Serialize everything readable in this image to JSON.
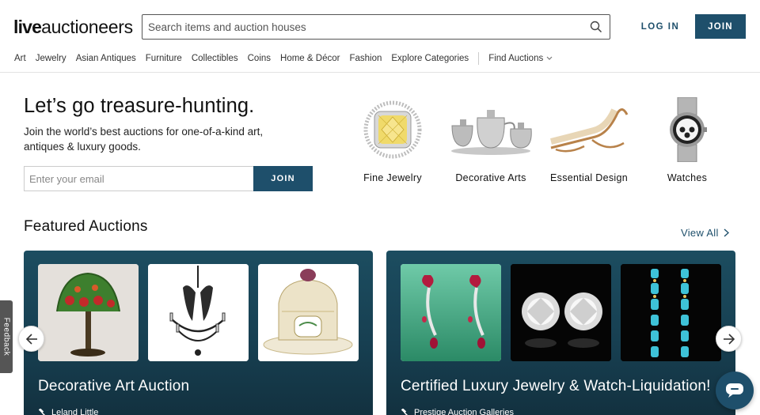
{
  "header": {
    "logo_live": "live",
    "logo_rest": "auctioneers",
    "search_placeholder": "Search items and auction houses",
    "login_label": "LOG IN",
    "join_label": "JOIN"
  },
  "nav": {
    "items": [
      "Art",
      "Jewelry",
      "Asian Antiques",
      "Furniture",
      "Collectibles",
      "Coins",
      "Home & Décor",
      "Fashion",
      "Explore Categories"
    ],
    "find_auctions": "Find Auctions"
  },
  "hero": {
    "title": "Let’s go treasure-hunting.",
    "subtitle": "Join the world’s best auctions for one-of-a-kind art, antiques & luxury goods.",
    "email_placeholder": "Enter your email",
    "join_label": "JOIN"
  },
  "categories": [
    {
      "label": "Fine Jewelry",
      "icon": "yellow-diamond-ring-image"
    },
    {
      "label": "Decorative Arts",
      "icon": "silver-tea-set-image"
    },
    {
      "label": "Essential Design",
      "icon": "lounge-chair-image"
    },
    {
      "label": "Watches",
      "icon": "chronograph-watch-image"
    }
  ],
  "featured": {
    "title": "Featured Auctions",
    "view_all": "View All",
    "auctions": [
      {
        "title": "Decorative Art Auction",
        "house": "Leland Little",
        "thumbs": [
          "tiffany-lamp-image",
          "iron-chandelier-image",
          "porcelain-dish-image"
        ]
      },
      {
        "title": "Certified Luxury Jewelry & Watch-Liquidation!",
        "house": "Prestige Auction Galleries",
        "thumbs": [
          "ruby-earrings-image",
          "diamond-studs-image",
          "turquoise-earrings-image"
        ]
      }
    ]
  },
  "feedback_label": "Feedback",
  "colors": {
    "brand": "#1e4f6b",
    "card_bg": "#173f51"
  }
}
